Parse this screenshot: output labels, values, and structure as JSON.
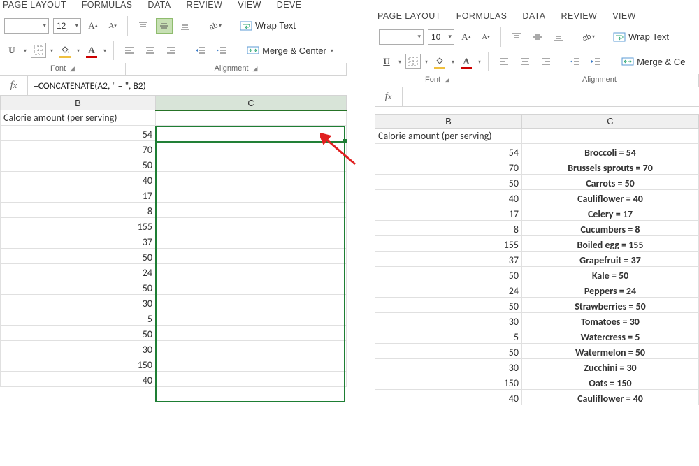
{
  "ribbon_tabs": [
    "PAGE LAYOUT",
    "FORMULAS",
    "DATA",
    "REVIEW",
    "VIEW",
    "DEVE"
  ],
  "ribbon_tabs_right": [
    "PAGE LAYOUT",
    "FORMULAS",
    "DATA",
    "REVIEW",
    "VIEW"
  ],
  "font_group_label": "Font",
  "alignment_group_label": "Alignment",
  "left": {
    "font_size": "12",
    "wrap_text": "Wrap Text",
    "merge_center": "Merge & Center",
    "formula": "=CONCATENATE(A2, \" = \", B2)",
    "col_headers": [
      "B",
      "C"
    ],
    "header_cell": "Calorie amount (per serving)",
    "col_b_values": [
      "54",
      "70",
      "50",
      "40",
      "17",
      "8",
      "155",
      "37",
      "50",
      "24",
      "50",
      "30",
      "5",
      "50",
      "30",
      "150",
      "40"
    ],
    "c2_value": "Broccoli = 54"
  },
  "right": {
    "font_size": "10",
    "wrap_text": "Wrap Text",
    "merge_center": "Merge & Ce",
    "formula": "",
    "col_headers": [
      "B",
      "C"
    ],
    "header_cell": "Calorie amount (per serving)",
    "rows": [
      {
        "b": "54",
        "c": "Broccoli = 54"
      },
      {
        "b": "70",
        "c": "Brussels sprouts = 70"
      },
      {
        "b": "50",
        "c": "Carrots = 50"
      },
      {
        "b": "40",
        "c": "Cauliflower = 40"
      },
      {
        "b": "17",
        "c": "Celery = 17"
      },
      {
        "b": "8",
        "c": "Cucumbers = 8"
      },
      {
        "b": "155",
        "c": "Boiled egg = 155"
      },
      {
        "b": "37",
        "c": "Grapefruit = 37"
      },
      {
        "b": "50",
        "c": "Kale = 50"
      },
      {
        "b": "24",
        "c": "Peppers = 24"
      },
      {
        "b": "50",
        "c": "Strawberries = 50"
      },
      {
        "b": "30",
        "c": "Tomatoes = 30"
      },
      {
        "b": "5",
        "c": "Watercress = 5"
      },
      {
        "b": "50",
        "c": "Watermelon = 50"
      },
      {
        "b": "30",
        "c": "Zucchini = 30"
      },
      {
        "b": "150",
        "c": "Oats = 150"
      },
      {
        "b": "40",
        "c": "Cauliflower = 40"
      }
    ]
  }
}
